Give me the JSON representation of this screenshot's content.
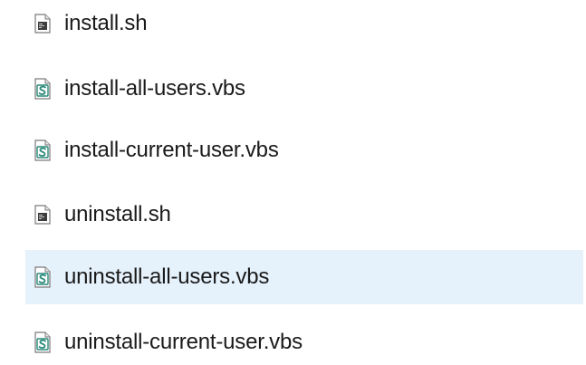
{
  "files": [
    {
      "name": "install.sh",
      "icon": "shell-script-file-icon",
      "selected": false
    },
    {
      "name": "install-all-users.vbs",
      "icon": "vbscript-file-icon",
      "selected": false
    },
    {
      "name": "install-current-user.vbs",
      "icon": "vbscript-file-icon",
      "selected": false
    },
    {
      "name": "uninstall.sh",
      "icon": "shell-script-file-icon",
      "selected": false
    },
    {
      "name": "uninstall-all-users.vbs",
      "icon": "vbscript-file-icon",
      "selected": true
    },
    {
      "name": "uninstall-current-user.vbs",
      "icon": "vbscript-file-icon",
      "selected": false
    }
  ],
  "colors": {
    "selection": "#e5f1fb",
    "text": "#1a1a1a",
    "vbs_icon_accent": "#2a8a7a"
  }
}
